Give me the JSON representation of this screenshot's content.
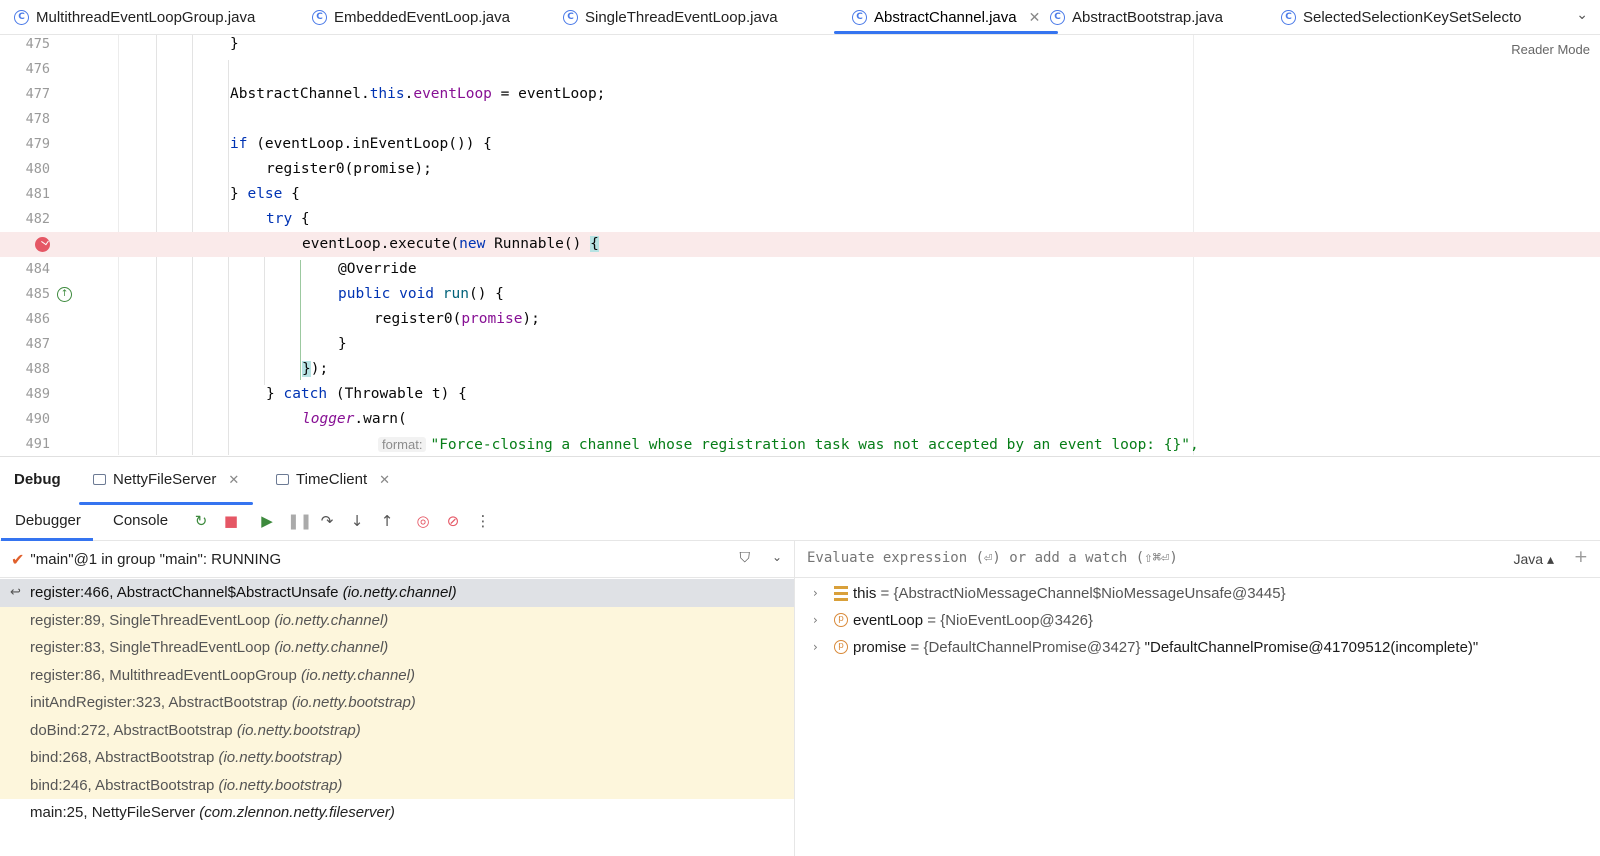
{
  "editor_tabs": [
    {
      "label": "MultithreadEventLoopGroup.java"
    },
    {
      "label": "EmbeddedEventLoop.java"
    },
    {
      "label": "SingleThreadEventLoop.java"
    },
    {
      "label": "AbstractChannel.java"
    },
    {
      "label": "AbstractBootstrap.java"
    },
    {
      "label": "SelectedSelectionKeySetSelecto"
    }
  ],
  "active_tab": "AbstractChannel.java",
  "reader_mode": "Reader Mode",
  "code_lines": [
    {
      "ln": "475",
      "text": "}"
    },
    {
      "ln": "476",
      "text": ""
    },
    {
      "ln": "477",
      "text": "AbstractChannel.this.eventLoop = eventLoop;"
    },
    {
      "ln": "478",
      "text": ""
    },
    {
      "ln": "479",
      "text": "if (eventLoop.inEventLoop()) {"
    },
    {
      "ln": "480",
      "text": "register0(promise);"
    },
    {
      "ln": "481",
      "text": "} else {"
    },
    {
      "ln": "482",
      "text": "try {"
    },
    {
      "ln": "",
      "text": "eventLoop.execute(new Runnable() {"
    },
    {
      "ln": "484",
      "text": "@Override"
    },
    {
      "ln": "485",
      "text": "public void run() {"
    },
    {
      "ln": "486",
      "text": "register0(promise);"
    },
    {
      "ln": "487",
      "text": "}"
    },
    {
      "ln": "488",
      "text": "});"
    },
    {
      "ln": "489",
      "text": "} catch (Throwable t) {"
    },
    {
      "ln": "490",
      "text": "logger.warn("
    },
    {
      "ln": "491",
      "text": "\"Force-closing a channel whose registration task was not accepted by an event loop: {}\","
    }
  ],
  "param_hint": "format:",
  "debug": {
    "title": "Debug",
    "sessions": [
      {
        "label": "NettyFileServer"
      },
      {
        "label": "TimeClient"
      }
    ],
    "tabs": {
      "debugger": "Debugger",
      "console": "Console"
    },
    "thread": "\"main\"@1 in group \"main\": RUNNING",
    "frames": [
      {
        "method": "register:466, AbstractChannel$AbstractUnsafe",
        "pkg": "(io.netty.channel)"
      },
      {
        "method": "register:89, SingleThreadEventLoop",
        "pkg": "(io.netty.channel)"
      },
      {
        "method": "register:83, SingleThreadEventLoop",
        "pkg": "(io.netty.channel)"
      },
      {
        "method": "register:86, MultithreadEventLoopGroup",
        "pkg": "(io.netty.channel)"
      },
      {
        "method": "initAndRegister:323, AbstractBootstrap",
        "pkg": "(io.netty.bootstrap)"
      },
      {
        "method": "doBind:272, AbstractBootstrap",
        "pkg": "(io.netty.bootstrap)"
      },
      {
        "method": "bind:268, AbstractBootstrap",
        "pkg": "(io.netty.bootstrap)"
      },
      {
        "method": "bind:246, AbstractBootstrap",
        "pkg": "(io.netty.bootstrap)"
      },
      {
        "method": "main:25, NettyFileServer",
        "pkg": "(com.zlennon.netty.fileserver)"
      }
    ],
    "eval_placeholder": "Evaluate expression (⏎) or add a watch (⇧⌘⏎)",
    "language": "Java",
    "variables": [
      {
        "name": "this",
        "eq": " = ",
        "value": "{AbstractNioMessageChannel$NioMessageUnsafe@3445}",
        "extra": ""
      },
      {
        "name": "eventLoop",
        "eq": " = ",
        "value": "{NioEventLoop@3426}",
        "extra": ""
      },
      {
        "name": "promise",
        "eq": " = ",
        "value": "{DefaultChannelPromise@3427}",
        "extra": " \"DefaultChannelPromise@41709512(incomplete)\""
      }
    ]
  }
}
